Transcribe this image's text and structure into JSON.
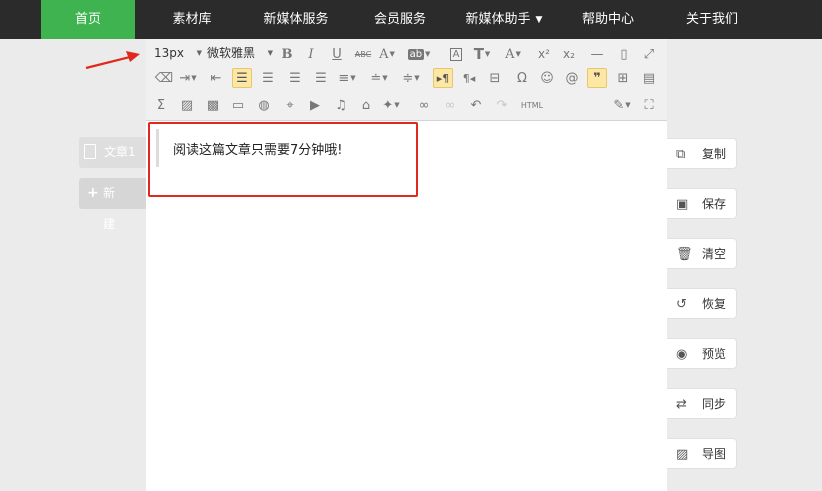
{
  "nav": {
    "items": [
      {
        "label": "首页",
        "active": true
      },
      {
        "label": "素材库"
      },
      {
        "label": "新媒体服务"
      },
      {
        "label": "会员服务"
      },
      {
        "label": "新媒体助手",
        "dropdown": true
      },
      {
        "label": "帮助中心"
      },
      {
        "label": "关于我们"
      }
    ]
  },
  "sidebar": {
    "doc_tab": "文章1",
    "new_button": "新 建"
  },
  "toolbar": {
    "font_size": "13px",
    "font_family": "微软雅黑",
    "row1": [
      "B",
      "I",
      "U",
      "ABC",
      "A",
      "ab",
      "A",
      "T",
      "A",
      "x²",
      "x₂",
      "—"
    ],
    "row3_html": "HTML"
  },
  "editor": {
    "content": "阅读这篇文章只需要7分钟哦!"
  },
  "actions": [
    {
      "label": "复制",
      "icon": "copy-icon"
    },
    {
      "label": "保存",
      "icon": "save-icon"
    },
    {
      "label": "清空",
      "icon": "trash-icon"
    },
    {
      "label": "恢复",
      "icon": "restore-icon"
    },
    {
      "label": "预览",
      "icon": "eye-icon"
    },
    {
      "label": "同步",
      "icon": "sync-icon"
    },
    {
      "label": "导图",
      "icon": "image-icon"
    }
  ],
  "colors": {
    "nav_bg": "#2b2b2b",
    "nav_active": "#3fb34f",
    "highlight": "#e0281d",
    "arrow": "#e0281d"
  }
}
